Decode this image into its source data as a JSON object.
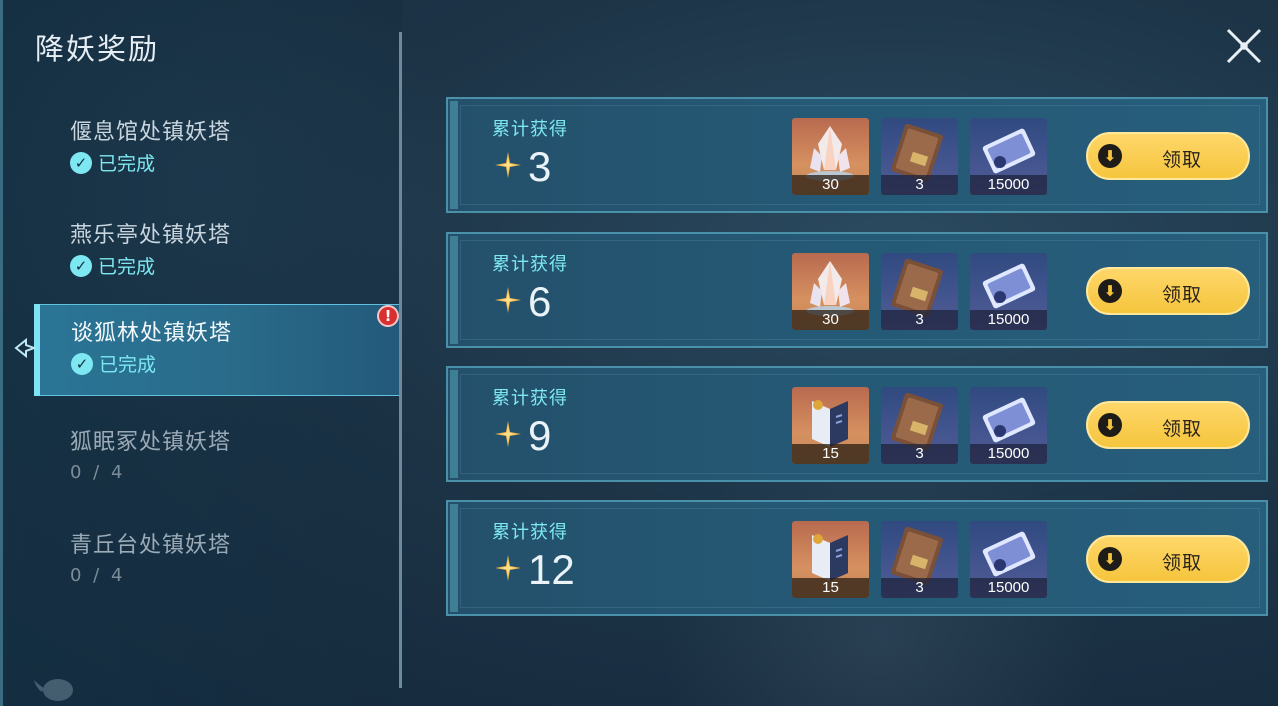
{
  "panel": {
    "title": "降妖奖励"
  },
  "towers": [
    {
      "name": "偃息馆处镇妖塔",
      "status": "已完成"
    },
    {
      "name": "燕乐亭处镇妖塔",
      "status": "已完成"
    },
    {
      "name": "谈狐林处镇妖塔",
      "status": "已完成",
      "selected": true,
      "alert": "!"
    },
    {
      "name": "狐眠冢处镇妖塔",
      "progress": "0 / 4"
    },
    {
      "name": "青丘台处镇妖塔",
      "progress": "0 / 4"
    }
  ],
  "rewards": [
    {
      "label": "累计获得",
      "count": "3",
      "items": [
        {
          "icon": "crystal-icon",
          "qty": "30"
        },
        {
          "icon": "book-icon",
          "qty": "3"
        },
        {
          "icon": "ticket-icon",
          "qty": "15000"
        }
      ],
      "button": "领取"
    },
    {
      "label": "累计获得",
      "count": "6",
      "items": [
        {
          "icon": "crystal-icon",
          "qty": "30"
        },
        {
          "icon": "book-icon",
          "qty": "3"
        },
        {
          "icon": "ticket-icon",
          "qty": "15000"
        }
      ],
      "button": "领取"
    },
    {
      "label": "累计获得",
      "count": "9",
      "items": [
        {
          "icon": "open-book-icon",
          "qty": "15"
        },
        {
          "icon": "book-icon",
          "qty": "3"
        },
        {
          "icon": "ticket-icon",
          "qty": "15000"
        }
      ],
      "button": "领取"
    },
    {
      "label": "累计获得",
      "count": "12",
      "items": [
        {
          "icon": "open-book-icon",
          "qty": "15"
        },
        {
          "icon": "book-icon",
          "qty": "3"
        },
        {
          "icon": "ticket-icon",
          "qty": "15000"
        }
      ],
      "button": "领取"
    }
  ],
  "colors": {
    "accent": "#7de8f2",
    "button": "#f5c53d",
    "alert": "#d9302f"
  }
}
